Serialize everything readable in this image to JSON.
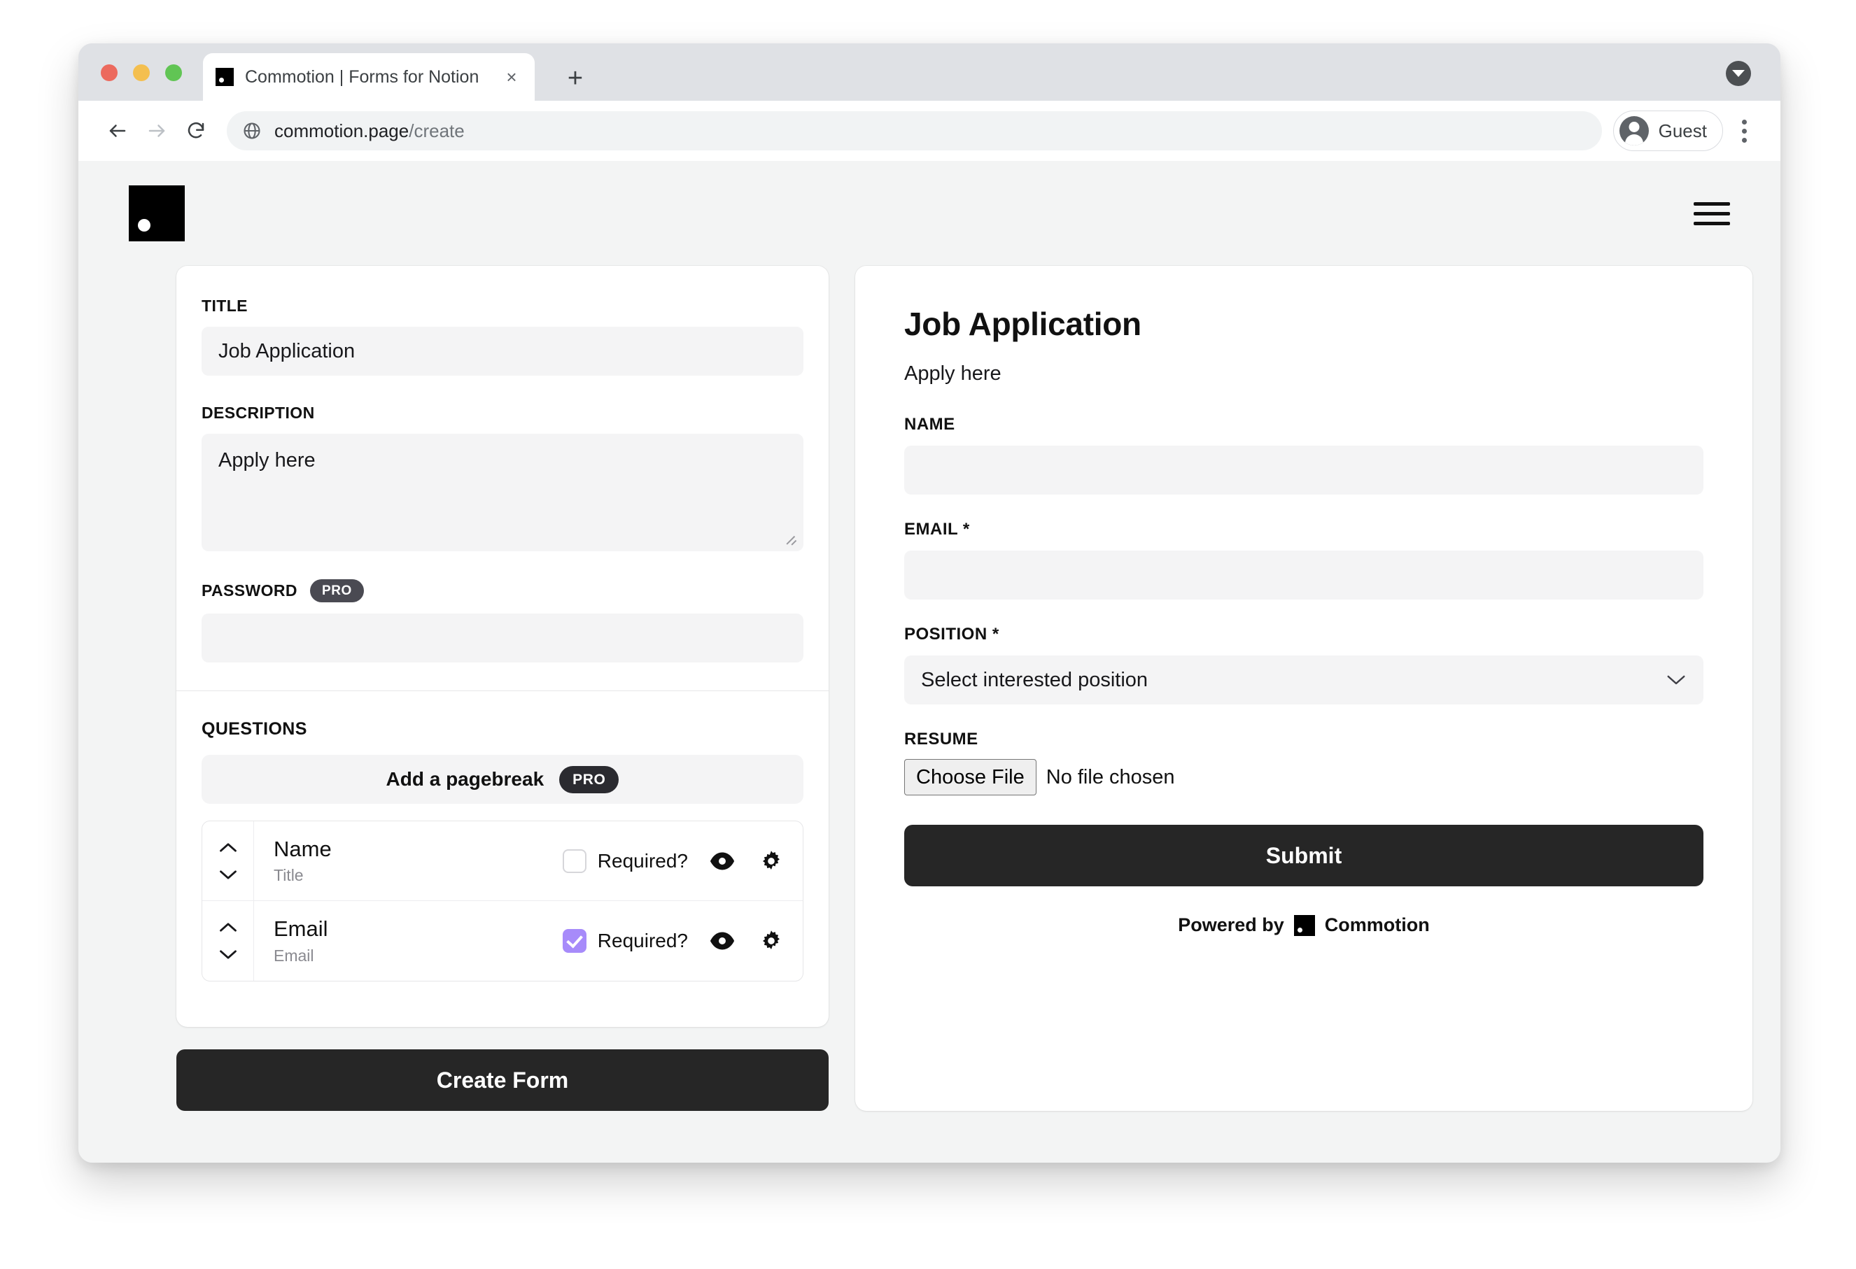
{
  "browser": {
    "tab": {
      "title": "Commotion | Forms for Notion",
      "favicon": "commotion-logo-icon",
      "close": "×"
    },
    "new_tab_label": "+",
    "url_bold": "commotion.page",
    "url_dim": "/create",
    "profile_name": "Guest"
  },
  "app": {
    "logo": "commotion-logo",
    "menu": "hamburger-menu"
  },
  "editor": {
    "title_label": "TITLE",
    "title_value": "Job Application",
    "description_label": "DESCRIPTION",
    "description_value": "Apply here",
    "password_label": "PASSWORD",
    "password_value": "",
    "pro_badge": "PRO",
    "questions_label": "QUESTIONS",
    "pagebreak_label": "Add a pagebreak",
    "pagebreak_pro": "PRO",
    "required_label": "Required?",
    "questions": [
      {
        "name": "Name",
        "type": "Title",
        "required": false
      },
      {
        "name": "Email",
        "type": "Email",
        "required": true
      }
    ],
    "create_button": "Create Form"
  },
  "preview": {
    "title": "Job Application",
    "description": "Apply here",
    "fields": [
      {
        "label": "NAME",
        "kind": "text",
        "value": ""
      },
      {
        "label": "EMAIL *",
        "kind": "text",
        "value": ""
      },
      {
        "label": "POSITION *",
        "kind": "select",
        "value": "Select interested position"
      },
      {
        "label": "RESUME",
        "kind": "file",
        "button": "Choose File",
        "status": "No file chosen"
      }
    ],
    "submit_label": "Submit",
    "powered_prefix": "Powered by",
    "powered_brand": "Commotion"
  },
  "colors": {
    "accent_purple": "#a78bfa",
    "dark": "#262626",
    "page_bg": "#f3f4f4",
    "field_bg": "#f4f4f5"
  }
}
